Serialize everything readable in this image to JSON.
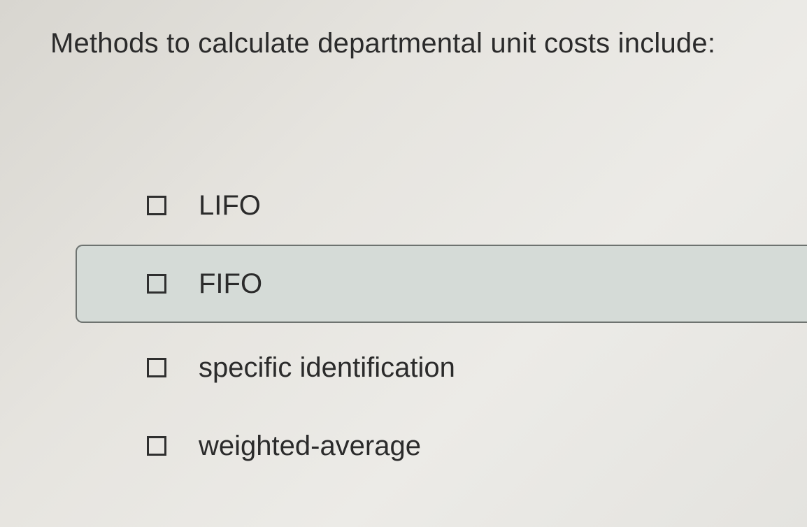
{
  "question": {
    "text": "Methods to calculate departmental unit costs include:"
  },
  "options": [
    {
      "label": "LIFO",
      "checked": false
    },
    {
      "label": "FIFO",
      "checked": false,
      "highlighted": true
    },
    {
      "label": "specific identification",
      "checked": false
    },
    {
      "label": "weighted-average",
      "checked": false
    }
  ]
}
